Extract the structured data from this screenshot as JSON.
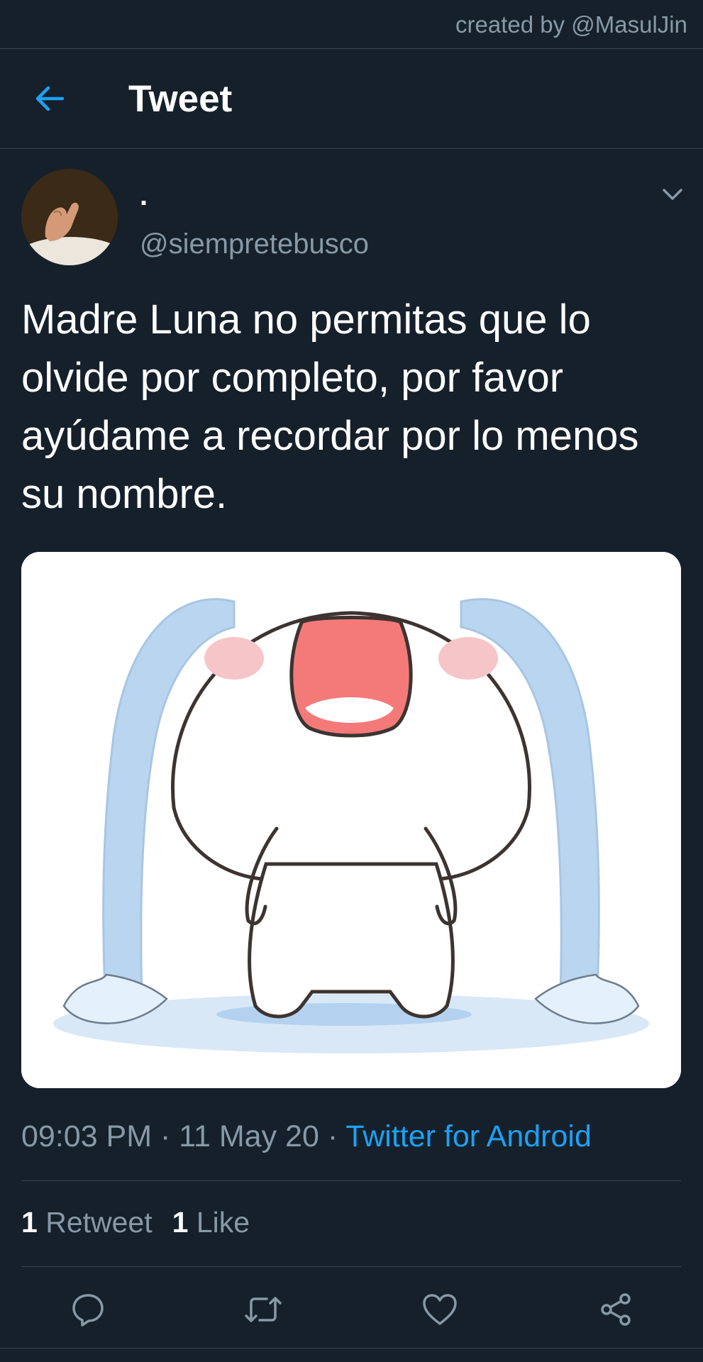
{
  "credit": "created by @MasulJin",
  "header": {
    "title": "Tweet",
    "back_icon": "arrow-left-icon"
  },
  "tweet": {
    "display_name": ".",
    "handle": "@siempretebusco",
    "text": "Madre Luna no permitas que lo olvide por completo, por favor ayúdame a recordar por lo menos su nombre.",
    "time": "09:03 PM",
    "date": "11 May 20",
    "separator": " · ",
    "source": "Twitter for Android",
    "retweets_count": "1",
    "retweets_label": "Retweet",
    "likes_count": "1",
    "likes_label": "Like"
  },
  "actions": {
    "reply_icon": "comment-icon",
    "retweet_icon": "retweet-icon",
    "like_icon": "heart-icon",
    "share_icon": "share-icon"
  },
  "colors": {
    "background": "#15202b",
    "accent": "#1da1f2",
    "secondary_text": "#8899a6",
    "divider": "#38444d"
  }
}
